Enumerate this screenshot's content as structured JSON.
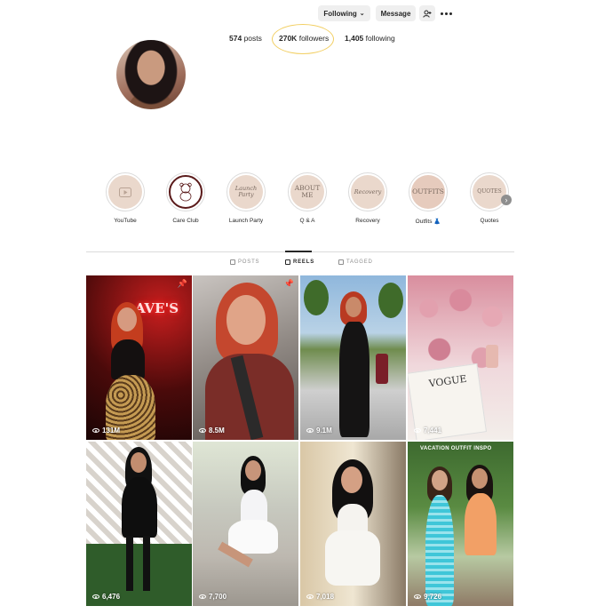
{
  "header": {
    "following_label": "Following",
    "message_label": "Message"
  },
  "stats": {
    "posts_count": "574",
    "posts_label": "posts",
    "followers_count": "270K",
    "followers_label": "followers",
    "following_count": "1,405",
    "following_label": "following"
  },
  "highlights": [
    {
      "label": "YouTube",
      "cover_text": ""
    },
    {
      "label": "Care Club",
      "cover_text": ""
    },
    {
      "label": "Launch Party",
      "cover_text": "Launch Party"
    },
    {
      "label": "Q & A",
      "cover_text": "ABOUT ME"
    },
    {
      "label": "Recovery",
      "cover_text": "Recovery"
    },
    {
      "label": "Outfits 👗",
      "cover_text": "OUTFITS"
    },
    {
      "label": "Quotes",
      "cover_text": "QUOTES"
    }
  ],
  "tabs": {
    "posts": "POSTS",
    "reels": "REELS",
    "tagged": "TAGGED",
    "active": "reels"
  },
  "reels": [
    {
      "views": "131M",
      "pinned": true
    },
    {
      "views": "8.5M",
      "pinned": true
    },
    {
      "views": "9.1M",
      "pinned": false
    },
    {
      "views": "7,441",
      "pinned": false
    },
    {
      "views": "6,476",
      "pinned": false
    },
    {
      "views": "7,700",
      "pinned": false
    },
    {
      "views": "7,018",
      "pinned": false
    },
    {
      "views": "9,726",
      "pinned": false,
      "caption": "VACATION OUTFIT INSPO"
    }
  ],
  "tile_text": {
    "neon_sign": "AVE'S",
    "magazine_title": "VOGUE"
  },
  "colors": {
    "highlight_circle": "#f2cf63",
    "button_bg": "#efefef",
    "highlight_bg": "#ead8cc"
  }
}
